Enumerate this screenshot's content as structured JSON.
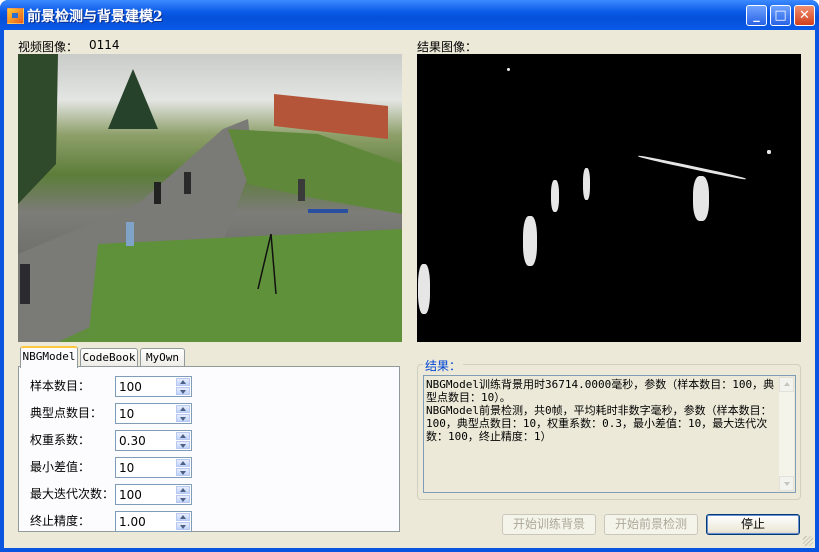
{
  "window": {
    "title": "前景检测与背景建模2",
    "minimize_glyph": "_",
    "maximize_glyph": "□",
    "close_glyph": "✕"
  },
  "video": {
    "label": "视频图像：",
    "frame_number": "0114"
  },
  "result_image": {
    "label": "结果图像："
  },
  "tabs": [
    {
      "label": "NBGModel",
      "active": true
    },
    {
      "label": "CodeBook",
      "active": false
    },
    {
      "label": "MyOwn",
      "active": false
    }
  ],
  "params": [
    {
      "label": "样本数目：",
      "value": "100"
    },
    {
      "label": "典型点数目：",
      "value": "10"
    },
    {
      "label": "权重系数：",
      "value": "0.30"
    },
    {
      "label": "最小差值：",
      "value": "10"
    },
    {
      "label": "最大迭代次数：",
      "value": "100"
    },
    {
      "label": "终止精度：",
      "value": "1.00"
    }
  ],
  "result_group": {
    "title": "结果：",
    "text": "NBGModel训练背景用时36714.0000毫秒，参数（样本数目：100，典型点数目：10）。\nNBGModel前景检测，共0帧，平均耗时非数字毫秒，参数（样本数目：100，典型点数目：10，权重系数：0.3，最小差值：10，最大迭代次数：100，终止精度：1）"
  },
  "buttons": {
    "train": "开始训练背景",
    "detect": "开始前景检测",
    "stop": "停止"
  },
  "colors": {
    "titlebar": "#0a5ae8",
    "client_bg": "#ece9d8",
    "group_title": "#0046d5"
  }
}
